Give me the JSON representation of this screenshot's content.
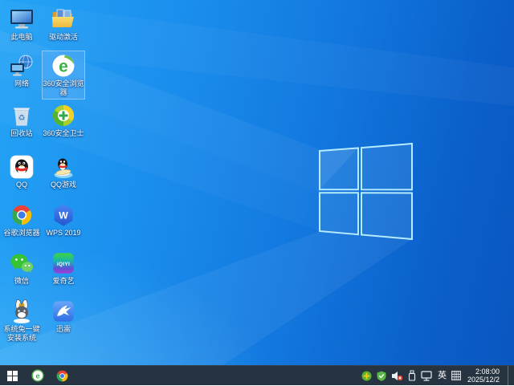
{
  "desktop": {
    "icons": [
      {
        "label": "此电脑"
      },
      {
        "label": "驱动激活"
      },
      {
        "label": "网络"
      },
      {
        "label": "360安全浏览器",
        "selected": true
      },
      {
        "label": "回收站"
      },
      {
        "label": "360安全卫士"
      },
      {
        "label": "QQ"
      },
      {
        "label": "QQ游戏"
      },
      {
        "label": "谷歌浏览器"
      },
      {
        "label": "WPS 2019"
      },
      {
        "label": "微信"
      },
      {
        "label": "爱奇艺"
      },
      {
        "label": "系统兔一键安装系统"
      },
      {
        "label": "迅雷"
      }
    ]
  },
  "glyphs": {
    "browser_e": "e",
    "wps_w": "W",
    "iqiyi_logo": "iQIYI",
    "recycle": "♻"
  },
  "taskbar": {
    "tray": {
      "lang": "英"
    },
    "clock": {
      "time": "2:08:00",
      "date": "2025/12/2"
    }
  },
  "colors": {
    "wallpaper_light": "#24a4f6",
    "wallpaper_dark": "#0a55c0",
    "taskbar": "#263340",
    "selection": "#69b4fa"
  }
}
